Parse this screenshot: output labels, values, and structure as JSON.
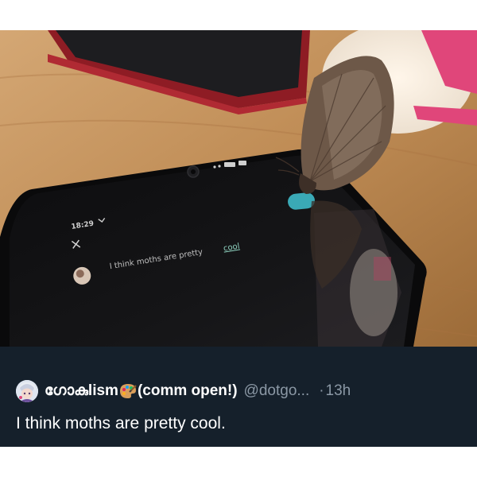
{
  "photo": {
    "phone_time": "18:29",
    "phone_message_prefix": "I think moths are pretty",
    "phone_message_link": "cool",
    "close_symbol": "×"
  },
  "tweet": {
    "display_name": "ഗോകുlism",
    "display_suffix": "(comm open!)",
    "handle": "@dotgo...",
    "separator": "·",
    "time": "13h",
    "text": "I think moths are pretty cool.",
    "avatar_icon": "anime-avatar-icon",
    "emoji_icon": "artist-palette-icon"
  },
  "colors": {
    "card_bg": "#15202b",
    "secondary_text": "#8b98a5",
    "primary_text": "#ffffff",
    "table_wood": "#b8864f"
  }
}
